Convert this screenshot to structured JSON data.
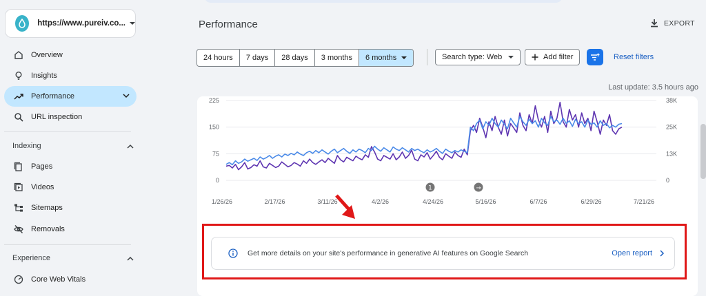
{
  "property": {
    "url": "https://www.pureiv.co..."
  },
  "sidebar": {
    "items": [
      {
        "label": "Overview"
      },
      {
        "label": "Insights"
      },
      {
        "label": "Performance"
      },
      {
        "label": "URL inspection"
      }
    ],
    "indexing": {
      "heading": "Indexing",
      "items": [
        {
          "label": "Pages"
        },
        {
          "label": "Videos"
        },
        {
          "label": "Sitemaps"
        },
        {
          "label": "Removals"
        }
      ]
    },
    "experience": {
      "heading": "Experience",
      "items": [
        {
          "label": "Core Web Vitals"
        }
      ]
    }
  },
  "header": {
    "title": "Performance",
    "export_label": "EXPORT"
  },
  "toolbar": {
    "date_tabs": [
      {
        "label": "24 hours"
      },
      {
        "label": "7 days"
      },
      {
        "label": "28 days"
      },
      {
        "label": "3 months"
      },
      {
        "label": "6 months"
      }
    ],
    "selected_tab": "6 months",
    "search_type": "Search type: Web",
    "add_filter": "Add filter",
    "reset_filters": "Reset filters"
  },
  "last_update": "Last update: 3.5 hours ago",
  "banner": {
    "message": "Get more details on your site's performance in generative AI features on Google Search",
    "action": "Open report"
  },
  "chart_data": {
    "type": "line",
    "x_labels": [
      "1/26/26",
      "2/17/26",
      "3/11/26",
      "4/2/26",
      "4/24/26",
      "5/16/26",
      "6/7/26",
      "6/29/26",
      "7/21/26"
    ],
    "left_axis": {
      "ticks": [
        "225",
        "150",
        "75",
        "0"
      ],
      "range": [
        0,
        225
      ]
    },
    "right_axis": {
      "ticks": [
        "38K",
        "25K",
        "13K",
        "0"
      ],
      "range": [
        0,
        38000
      ]
    },
    "annotations": [
      "1",
      "→"
    ],
    "series": [
      {
        "color": "#5e35b1",
        "values": [
          40,
          42,
          35,
          45,
          30,
          38,
          50,
          32,
          36,
          44,
          40,
          55,
          38,
          35,
          48,
          42,
          36,
          40,
          52,
          45,
          38,
          42,
          50,
          46,
          40,
          55,
          48,
          60,
          50,
          45,
          52,
          58,
          50,
          62,
          55,
          48,
          70,
          58,
          52,
          65,
          60,
          55,
          68,
          62,
          58,
          72,
          65,
          95,
          80,
          60,
          55,
          70,
          65,
          60,
          75,
          58,
          66,
          80,
          62,
          70,
          85,
          60,
          55,
          72,
          66,
          78,
          60,
          70,
          82,
          65,
          58,
          75,
          68,
          62,
          80,
          70,
          65,
          88,
          72,
          140,
          155,
          135,
          175,
          150,
          120,
          165,
          140,
          180,
          150,
          130,
          170,
          125,
          160,
          148,
          135,
          190,
          155,
          140,
          185,
          160,
          210,
          170,
          150,
          180,
          135,
          195,
          160,
          175,
          220,
          165,
          150,
          200,
          170,
          185,
          150,
          190,
          160,
          175,
          140,
          195,
          165,
          130,
          170,
          155,
          185,
          140,
          130,
          145,
          150
        ]
      },
      {
        "color": "#4a8ae8",
        "values": [
          45,
          50,
          44,
          55,
          48,
          52,
          60,
          54,
          58,
          62,
          56,
          66,
          60,
          64,
          70,
          62,
          68,
          72,
          66,
          74,
          70,
          76,
          72,
          80,
          74,
          70,
          78,
          82,
          76,
          84,
          78,
          86,
          80,
          74,
          82,
          88,
          78,
          84,
          90,
          82,
          76,
          86,
          80,
          88,
          84,
          78,
          90,
          84,
          96,
          88,
          82,
          92,
          86,
          80,
          94,
          88,
          84,
          92,
          86,
          80,
          90,
          84,
          88,
          82,
          78,
          86,
          80,
          84,
          90,
          82,
          76,
          88,
          82,
          78,
          84,
          80,
          86,
          82,
          78,
          150,
          140,
          160,
          170,
          145,
          165,
          155,
          175,
          160,
          150,
          170,
          158,
          145,
          175,
          162,
          150,
          180,
          165,
          155,
          172,
          160,
          168,
          150,
          175,
          162,
          155,
          180,
          165,
          170,
          158,
          175,
          160,
          168,
          152,
          172,
          160,
          165,
          150,
          170,
          158,
          162,
          150,
          168,
          155,
          160,
          148,
          155,
          150,
          158,
          160
        ]
      }
    ]
  }
}
